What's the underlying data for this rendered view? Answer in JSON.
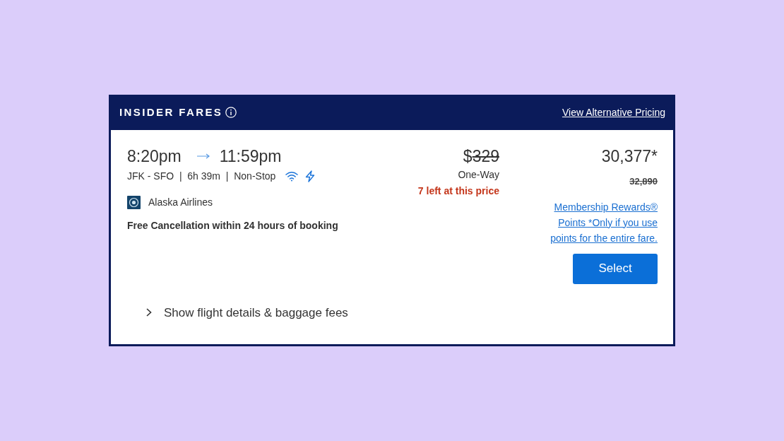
{
  "header": {
    "title": "INSIDER FARES",
    "link": "View Alternative Pricing"
  },
  "flight": {
    "depart": "8:20pm",
    "arrive": "11:59pm",
    "summary": "JFK - SFO  |  6h 39m  |  Non-Stop",
    "amenities": [
      {
        "kind": "wifi"
      },
      {
        "kind": "power"
      }
    ],
    "airline": "Alaska Airlines",
    "policy": "Free Cancellation within 24 hours of booking"
  },
  "price": {
    "currency": "$",
    "amount": "329",
    "struck": true,
    "trip_type": "One-Way",
    "availability": "7 left at this price"
  },
  "points": {
    "value": "30,377*",
    "original": "32,890",
    "original_struck": true,
    "note": "Membership Rewards® Points *Only if you use points for the entire fare."
  },
  "select_button": "Select",
  "details_toggle": {
    "label": "Show flight details & baggage fees",
    "expanded": false
  }
}
